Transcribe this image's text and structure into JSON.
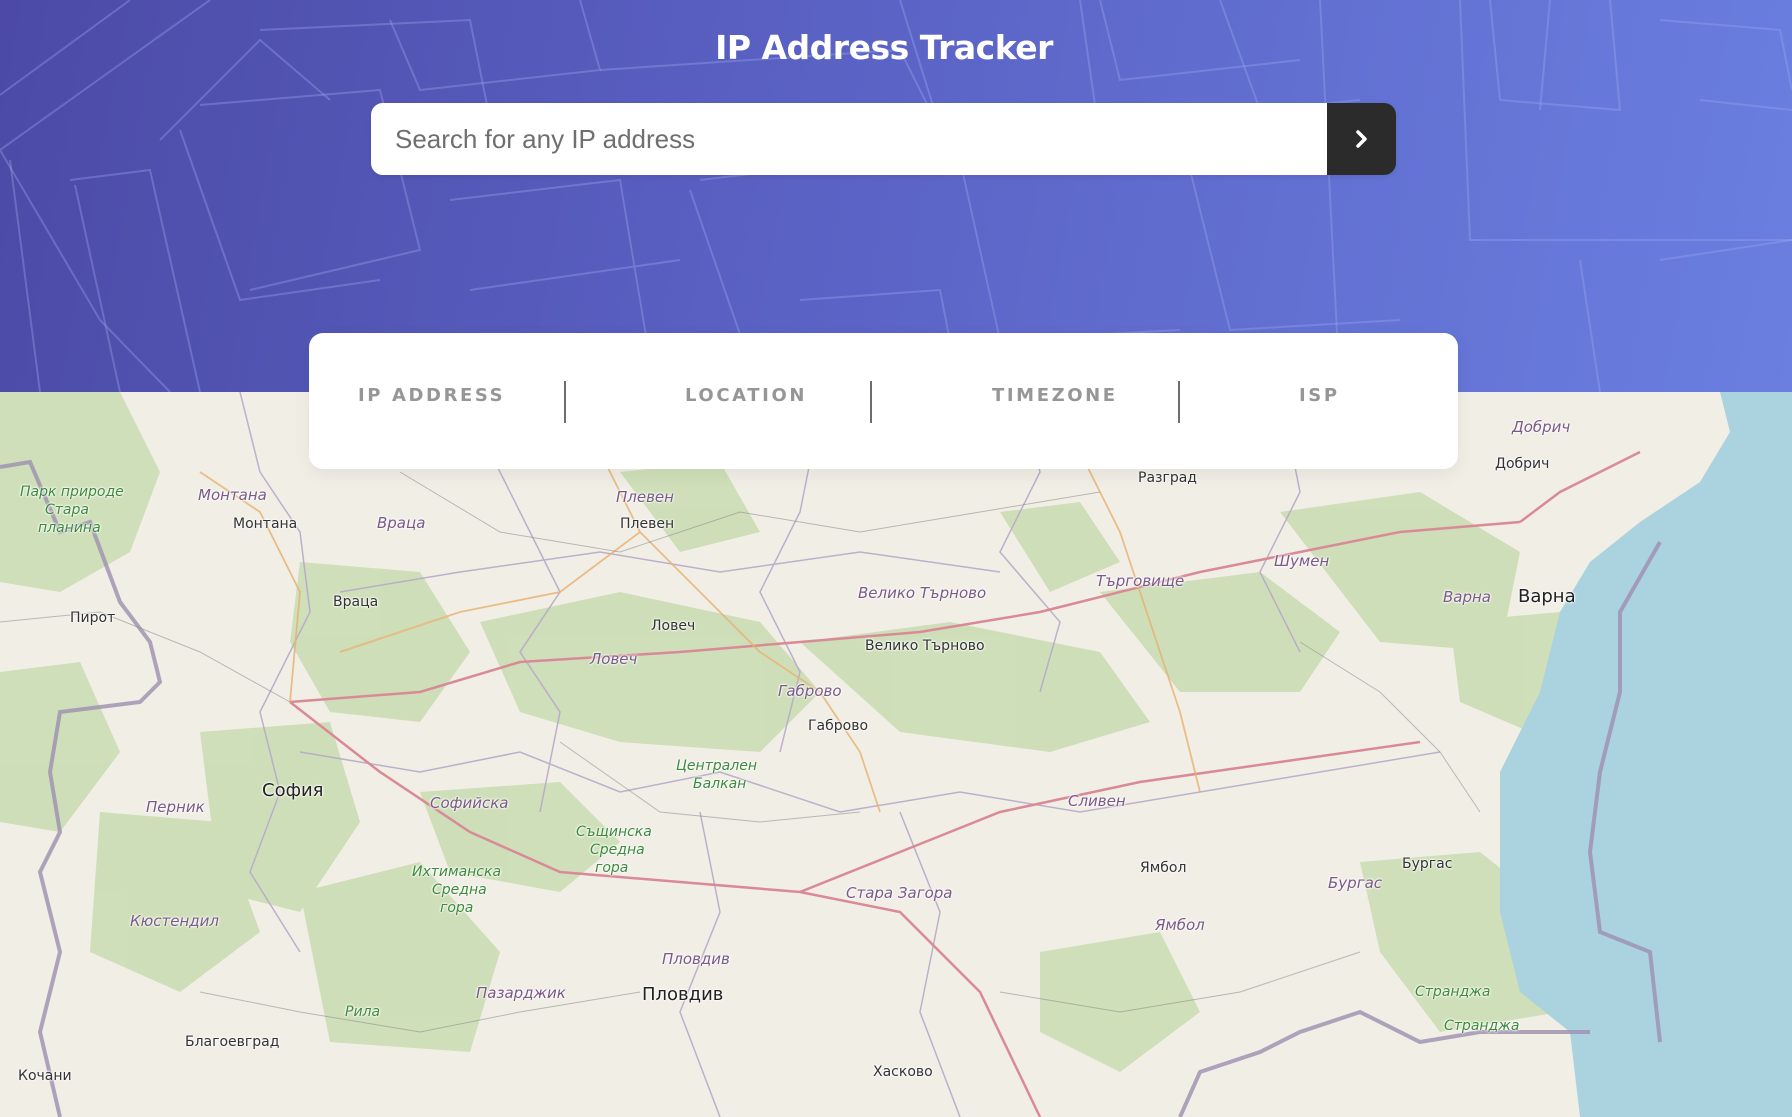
{
  "header": {
    "title": "IP Address Tracker",
    "search_placeholder": "Search for any IP address",
    "search_value": "",
    "submit_icon": "chevron-right-icon",
    "accent_color": "#2b2b2b"
  },
  "info_card": {
    "columns": [
      {
        "label": "IP ADDRESS",
        "value": ""
      },
      {
        "label": "LOCATION",
        "value": ""
      },
      {
        "label": "TIMEZONE",
        "value": ""
      },
      {
        "label": "ISP",
        "value": ""
      }
    ]
  },
  "map": {
    "regions": [
      "Добрич",
      "Монтана",
      "Враца",
      "Плевен",
      "Шумен",
      "Търговище",
      "Варна",
      "Велико Търново",
      "Ловеч",
      "Габрово",
      "Софийска",
      "Перник",
      "Сливен",
      "Кюстендил",
      "Стара Загора",
      "Бургас",
      "Пловдив",
      "Пазарджик",
      "Ямбол"
    ],
    "cities": [
      "Добрич",
      "Разград",
      "Монтана",
      "Плевен",
      "Пирот",
      "Враца",
      "Ловеч",
      "Варна",
      "Велико Търново",
      "Габрово",
      "София",
      "Ямбол",
      "Бургас",
      "Пловдив",
      "Благоевград",
      "Кочани",
      "Хасково"
    ],
    "parks": [
      "Парк природе",
      "Стара",
      "планина",
      "Централен",
      "Балкан",
      "Същинска",
      "Средна",
      "гора",
      "Ихтиманска",
      "Средна",
      "гора",
      "Рила",
      "Странджа",
      "Странджа"
    ]
  }
}
